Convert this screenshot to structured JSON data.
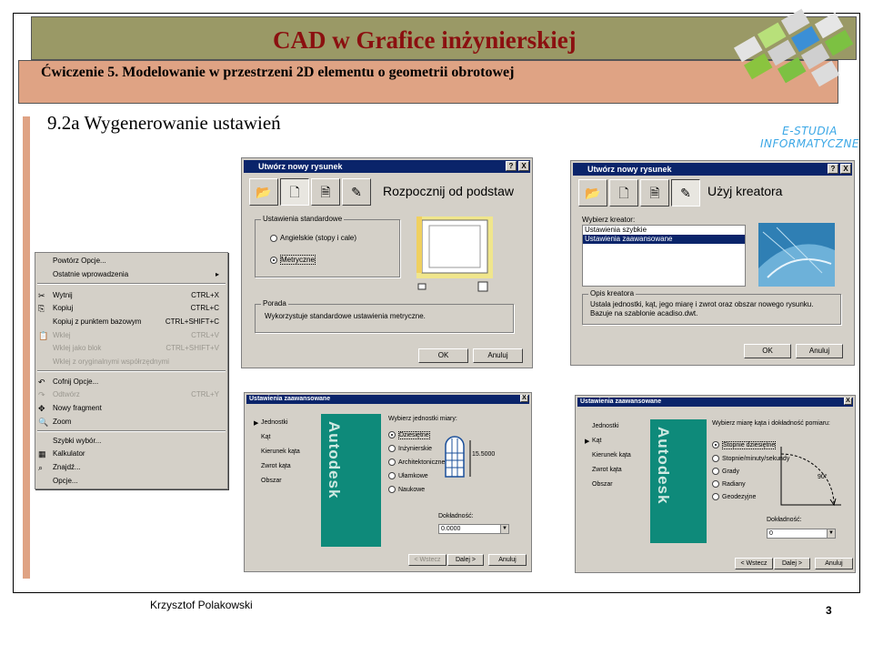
{
  "slide": {
    "title": "CAD w Grafice inżynierskiej",
    "subtitle": "Ćwiczenie 5. Modelowanie w przestrzeni 2D elementu o geometrii obrotowej",
    "heading": "9.2a Wygenerowanie ustawień",
    "logo_line1": "E-STUDIA",
    "logo_line2": "INFORMATYCZNE",
    "author": "Krzysztof Polakowski",
    "page": "3",
    "colors": {
      "title_bar": "#9a9966",
      "subtitle_bar": "#dfa384",
      "title_text": "#8b1010",
      "logo_text": "#3aa7e6"
    }
  },
  "context_menu": {
    "items": [
      {
        "label": "Powtórz Opcje...",
        "shortcut": "",
        "icon": "",
        "disabled": false
      },
      {
        "label": "Ostatnie wprowadzenia",
        "shortcut": "▸",
        "icon": "",
        "disabled": false
      },
      {
        "label": "Wytnij",
        "shortcut": "CTRL+X",
        "icon": "✂",
        "disabled": false
      },
      {
        "label": "Kopiuj",
        "shortcut": "CTRL+C",
        "icon": "⎘",
        "disabled": false
      },
      {
        "label": "Kopiuj z punktem bazowym",
        "shortcut": "CTRL+SHIFT+C",
        "icon": "",
        "disabled": false
      },
      {
        "label": "Wklej",
        "shortcut": "CTRL+V",
        "icon": "📋",
        "disabled": true
      },
      {
        "label": "Wklej jako blok",
        "shortcut": "CTRL+SHIFT+V",
        "icon": "",
        "disabled": true
      },
      {
        "label": "Wklej z oryginalnymi współrzędnymi",
        "shortcut": "",
        "icon": "",
        "disabled": true
      },
      {
        "label": "Cofnij Opcje...",
        "shortcut": "",
        "icon": "↶",
        "disabled": false
      },
      {
        "label": "Odtwórz",
        "shortcut": "CTRL+Y",
        "icon": "↷",
        "disabled": true
      },
      {
        "label": "Nowy fragment",
        "shortcut": "",
        "icon": "✥",
        "disabled": false
      },
      {
        "label": "Zoom",
        "shortcut": "",
        "icon": "🔍",
        "disabled": false
      },
      {
        "label": "Szybki wybór...",
        "shortcut": "",
        "icon": "",
        "disabled": false
      },
      {
        "label": "Kalkulator",
        "shortcut": "",
        "icon": "▦",
        "disabled": false
      },
      {
        "label": "Znajdź...",
        "shortcut": "",
        "icon": "⌕",
        "disabled": false
      },
      {
        "label": "Opcje...",
        "shortcut": "",
        "icon": "",
        "disabled": false
      }
    ]
  },
  "dialog_start": {
    "title": "Utwórz nowy rysunek",
    "heading": "Rozpocznij od podstaw",
    "group_label": "Ustawienia standardowe",
    "radio_imperial": "Angielskie (stopy i cale)",
    "radio_metric": "Metryczne",
    "hint_label": "Porada",
    "hint_text": "Wykorzystuje standardowe ustawienia metryczne.",
    "ok": "OK",
    "cancel": "Anuluj",
    "help": "?",
    "close": "X"
  },
  "dialog_wizard": {
    "title": "Utwórz nowy rysunek",
    "heading": "Użyj kreatora",
    "list_label": "Wybierz kreator:",
    "list_items": [
      "Ustawienia szybkie",
      "Ustawienia zaawansowane"
    ],
    "desc_label": "Opis kreatora",
    "desc_text": "Ustala jednostki, kąt, jego miarę i zwrot oraz obszar nowego rysunku. Bazuje na szablonie acadiso.dwt.",
    "ok": "OK",
    "cancel": "Anuluj",
    "help": "?",
    "close": "X"
  },
  "dialog_units": {
    "title": "Ustawienia zaawansowane",
    "nav": [
      "Jednostki",
      "Kąt",
      "Kierunek kąta",
      "Zwrot kąta",
      "Obszar"
    ],
    "active_nav": "Jednostki",
    "brand": "Autodesk",
    "prompt": "Wybierz jednostki miary:",
    "options": [
      "Dziesiętne",
      "Inżynierskie",
      "Architektoniczne",
      "Ułamkowe",
      "Naukowe"
    ],
    "selected": "Dziesiętne",
    "dimension": "15.5000",
    "precision_label": "Dokładność:",
    "precision_value": "0.0000",
    "back": "< Wstecz",
    "next": "Dalej >",
    "cancel": "Anuluj",
    "close": "X"
  },
  "dialog_angle": {
    "title": "Ustawienia zaawansowane",
    "nav": [
      "Jednostki",
      "Kąt",
      "Kierunek kąta",
      "Zwrot kąta",
      "Obszar"
    ],
    "active_nav": "Kąt",
    "brand": "Autodesk",
    "prompt": "Wybierz miarę kąta i dokładność pomiaru:",
    "options": [
      "Stopnie dziesiętne",
      "Stopnie/minuty/sekundy",
      "Grady",
      "Radiany",
      "Geodezyjne"
    ],
    "selected": "Stopnie dziesiętne",
    "angle_label": "90°",
    "precision_label": "Dokładność:",
    "precision_value": "0",
    "back": "< Wstecz",
    "next": "Dalej >",
    "cancel": "Anuluj",
    "close": "X"
  }
}
